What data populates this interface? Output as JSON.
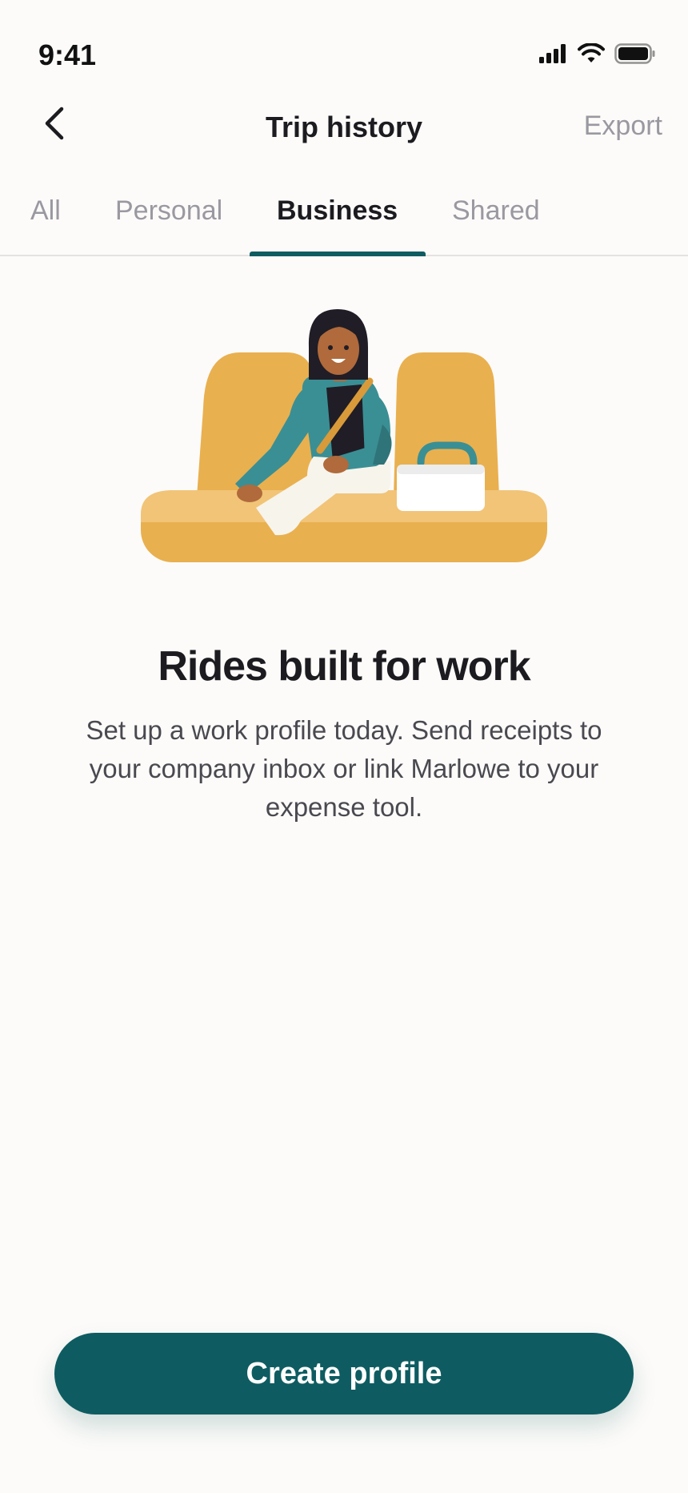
{
  "status_bar": {
    "time": "9:41",
    "icons": [
      "signal-icon",
      "wifi-icon",
      "battery-icon"
    ]
  },
  "nav": {
    "title": "Trip history",
    "export_label": "Export",
    "back_icon": "chevron-left-icon"
  },
  "tabs": [
    {
      "label": "All",
      "active": false
    },
    {
      "label": "Personal",
      "active": false
    },
    {
      "label": "Business",
      "active": true
    },
    {
      "label": "Shared",
      "active": false
    }
  ],
  "empty_state": {
    "illustration": "person-in-car-seat-illustration",
    "heading": "Rides built for work",
    "description": "Set up a work profile today. Send receipts to your company inbox or link Marlowe to your expense tool."
  },
  "cta": {
    "label": "Create profile"
  },
  "colors": {
    "accent": "#0e5c61",
    "background": "#fcfbf9",
    "seat": "#e9b04f",
    "inactive_text": "#9a98a0"
  }
}
